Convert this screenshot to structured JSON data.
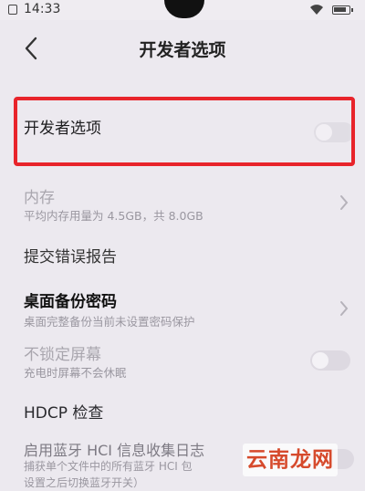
{
  "status_bar": {
    "time": "14:33"
  },
  "header": {
    "title": "开发者选项"
  },
  "settings": [
    {
      "title": "开发者选项"
    },
    {
      "title": "内存",
      "subtitle": "平均内存用量为 4.5GB，共 8.0GB"
    },
    {
      "title": "提交错误报告"
    },
    {
      "title": "桌面备份密码",
      "subtitle": "桌面完整备份当前未设置密码保护"
    },
    {
      "title": "不锁定屏幕",
      "subtitle": "充电时屏幕不会休眠"
    },
    {
      "title": "HDCP 检查"
    },
    {
      "title": "启用蓝牙 HCI 信息收集日志",
      "subtitle": "捕获单个文件中的所有蓝牙 HCI 包",
      "subtitle2": "设置之后切换蓝牙开关）"
    }
  ],
  "watermark": {
    "text": "云南龙网"
  },
  "colors": {
    "highlight": "#e8242b",
    "background": "#ece9ef"
  },
  "icons": {
    "back": "chevron-left-icon",
    "chevron": "chevron-right-icon"
  }
}
